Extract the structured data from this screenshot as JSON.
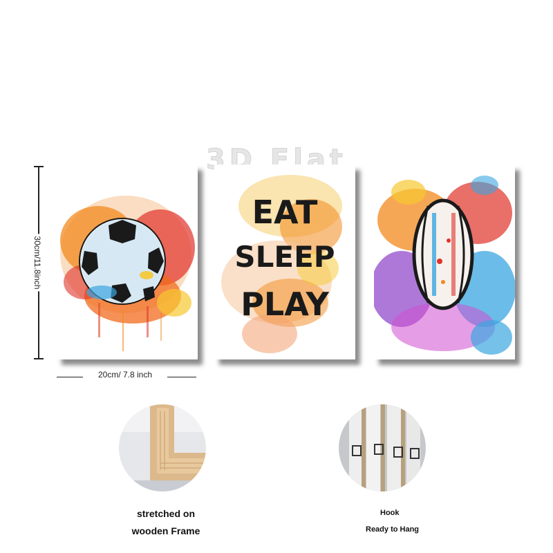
{
  "watermark": "3D Flat",
  "panels": [
    {
      "name": "soccer-ball-print"
    },
    {
      "name": "eat-sleep-play-print",
      "lines": [
        "EAT",
        "SLEEP",
        "PLAY"
      ]
    },
    {
      "name": "rugby-ball-print"
    }
  ],
  "dimensions": {
    "height_label": "30cm/11.8inch",
    "width_label": "20cm/ 7.8 inch"
  },
  "details": [
    {
      "name": "wooden-frame-closeup",
      "caption_lines": [
        "stretched on",
        "wooden Frame"
      ]
    },
    {
      "name": "hook-closeup",
      "caption_lines": [
        "Hook",
        "Ready to Hang"
      ]
    }
  ],
  "colors": {
    "splash_orange": "#f28a1e",
    "splash_red": "#e0322a",
    "splash_blue": "#3aa6e0",
    "splash_purple": "#8b3fc9",
    "splash_yellow": "#f6c730",
    "ink": "#1a1a1a"
  }
}
